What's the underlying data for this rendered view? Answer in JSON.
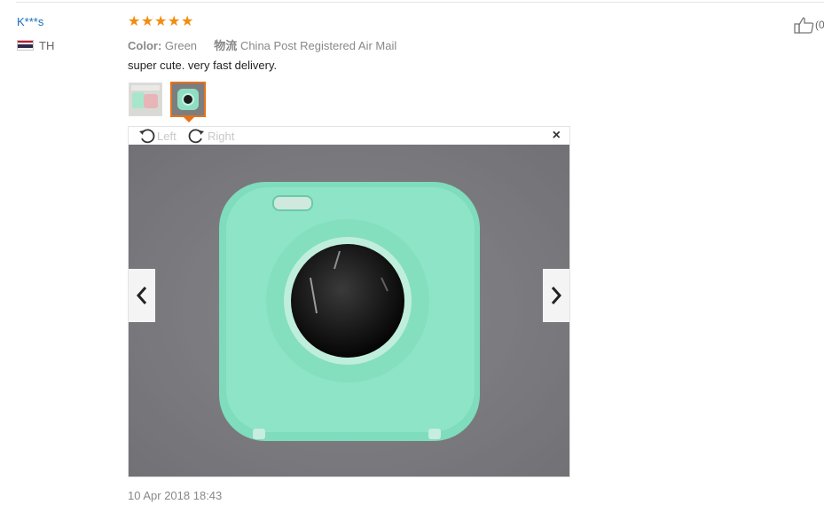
{
  "review": {
    "user": "K***s",
    "country_code": "TH",
    "rating": 5,
    "stars": [
      "★",
      "★",
      "★",
      "★",
      "★"
    ],
    "color_label": "Color:",
    "color_value": "Green",
    "shipping_label": "物流",
    "shipping_value": "China Post Registered Air Mail",
    "text": "super cute. very fast delivery.",
    "date": "10 Apr 2018 18:43",
    "like_count": "(0"
  },
  "viewer": {
    "rotate_left_label": "Left",
    "rotate_right_label": "Right",
    "close_glyph": "×"
  },
  "icons": {
    "rotate_left": "rotate-left-icon",
    "rotate_right": "rotate-right-icon",
    "prev": "chevron-left-icon",
    "next": "chevron-right-icon",
    "like": "thumbs-up-icon"
  },
  "colors": {
    "user_link": "#1a6dbb",
    "star": "#f28c0f",
    "thumb_selected": "#e6721c",
    "camera_body": "#88e3c4"
  }
}
